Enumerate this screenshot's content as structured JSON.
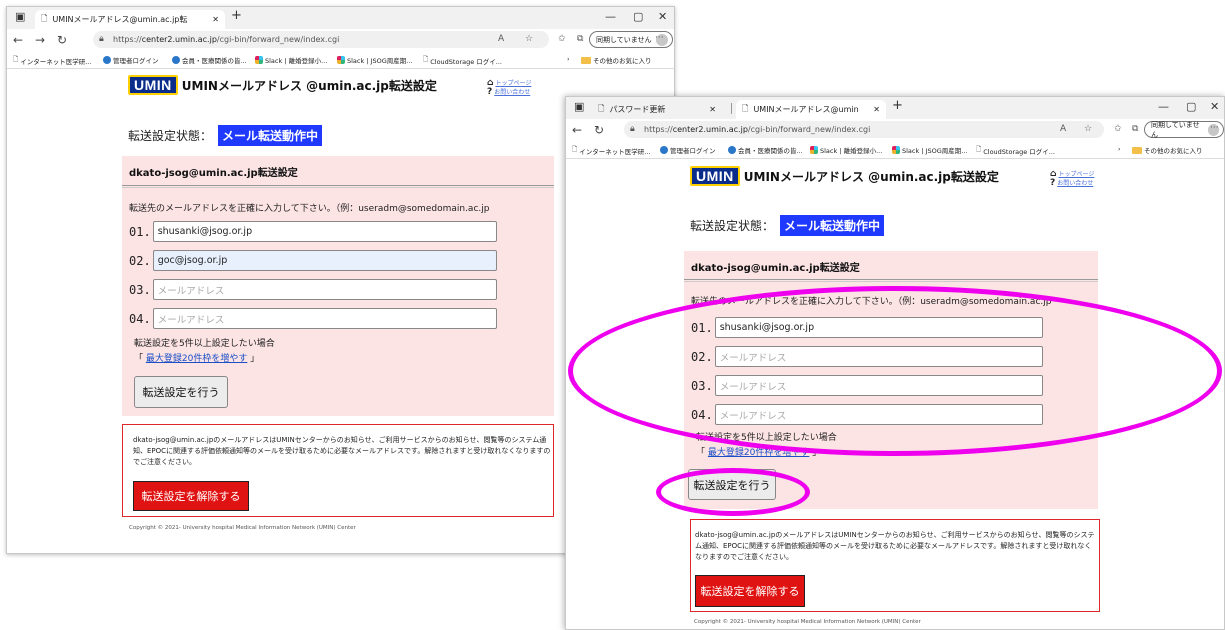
{
  "browser1": {
    "tab_title": "UMINメールアドレス@umin.ac.jp転",
    "url_prefix": "https://",
    "url_host": "center2.umin.ac.jp",
    "url_path": "/cgi-bin/forward_new/index.cgi",
    "sync_label": "同期していません",
    "bookmarks": [
      "インターネット医学研...",
      "管理者ログイン",
      "会員・医療関係の皆...",
      "Slack | 離婚登録小...",
      "Slack | JSOG周産期...",
      "CloudStorage ログイ..."
    ],
    "other_favorites": "その他のお気に入り"
  },
  "browser2": {
    "tab_inactive_title": "パスワード更新",
    "tab_title": "UMINメールアドレス@umin.ac.jp転",
    "url_prefix": "https://",
    "url_host": "center2.umin.ac.jp",
    "url_path": "/cgi-bin/forward_new/index.cgi",
    "sync_label": "同期していません",
    "bookmarks": [
      "インターネット医学研...",
      "管理者ログイン",
      "会員・医療関係の皆...",
      "Slack | 離婚登録小...",
      "Slack | JSOG周産期...",
      "CloudStorage ログイ..."
    ],
    "other_favorites": "その他のお気に入り"
  },
  "page": {
    "logo_text": "UMIN",
    "title": "UMINメールアドレス @umin.ac.jp転送設定",
    "top_link": "トップページ",
    "contact_link": "お問い合わせ",
    "status_label": "転送設定状態：",
    "status_badge": "メール転送動作中",
    "panel_title": "dkato-jsog@umin.ac.jp転送設定",
    "instruction": "転送先のメールアドレスを正確に入力して下さい。（例：useradm@somedomain.ac.jp",
    "placeholder": "メールアドレス",
    "more_text": "転送設定を5件以上設定したい場合",
    "more_bracket_open": "「",
    "more_link": "最大登録20件枠を増やす",
    "more_bracket_close": "」",
    "submit_label": "転送設定を行う",
    "notice_text": "dkato-jsog@umin.ac.jpのメールアドレスはUMINセンターからのお知らせ、ご利用サービスからのお知らせ、閲覧等のシステム通知、EPOCに関連する評価依頼通知等のメールを受け取るために必要なメールアドレスです。解除されますと受け取れなくなりますのでご注意ください。",
    "release_label": "転送設定を解除する",
    "copyright": "Copyright © 2021- University hospital Medical Information Network (UMIN) Center"
  },
  "form1": {
    "rows": [
      {
        "num": "01.",
        "value": "shusanki@jsog.or.jp"
      },
      {
        "num": "02.",
        "value": "goc@jsog.or.jp"
      },
      {
        "num": "03.",
        "value": ""
      },
      {
        "num": "04.",
        "value": ""
      }
    ]
  },
  "form2": {
    "rows": [
      {
        "num": "01.",
        "value": "shusanki@jsog.or.jp"
      },
      {
        "num": "02.",
        "value": ""
      },
      {
        "num": "03.",
        "value": ""
      },
      {
        "num": "04.",
        "value": ""
      }
    ]
  },
  "annotation_color": "#ee00ee",
  "status_badge_color": "#1f39ff",
  "release_button_color": "#e01313"
}
